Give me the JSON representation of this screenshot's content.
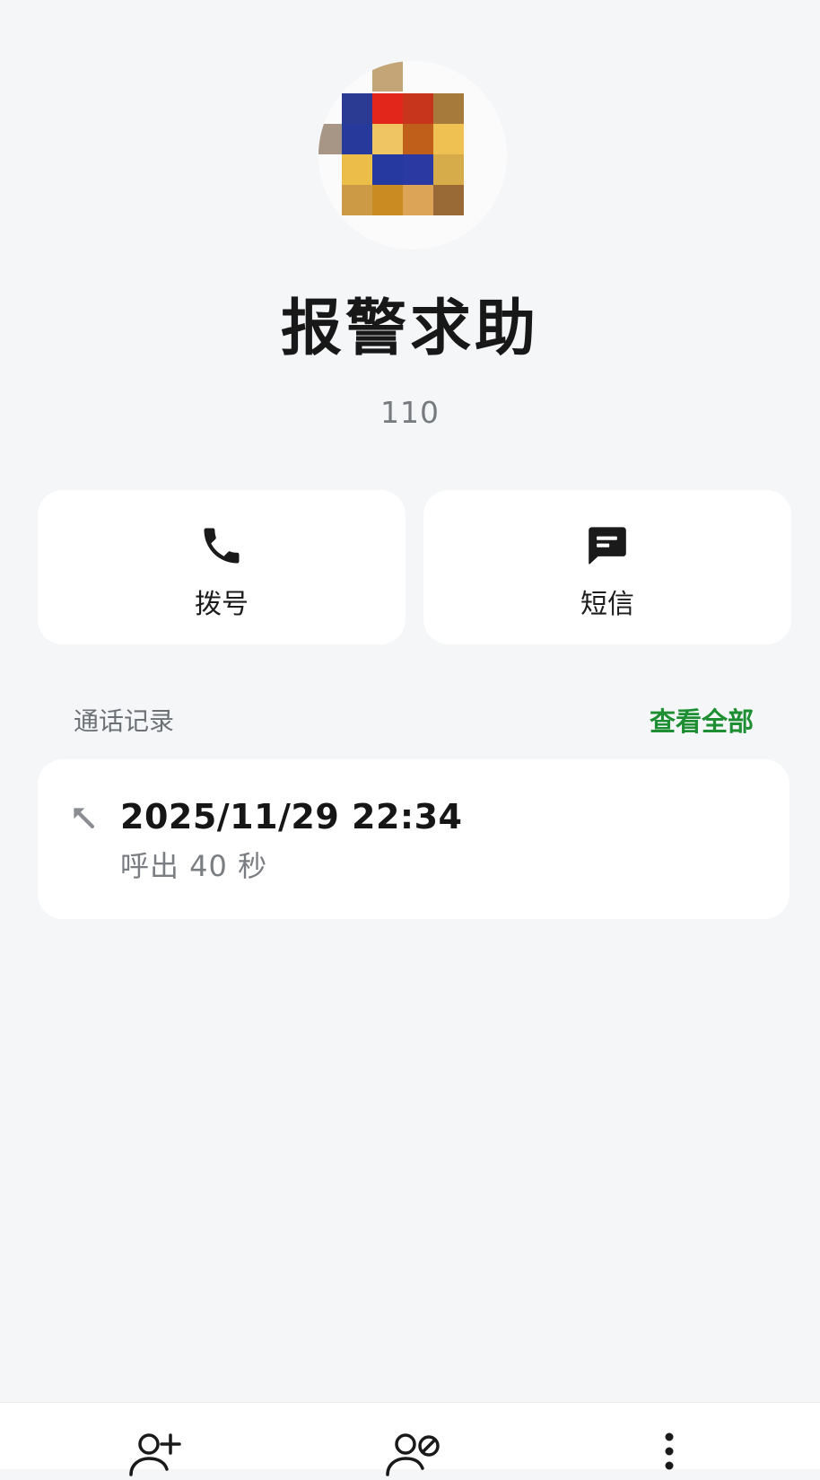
{
  "contact": {
    "name": "报警求助",
    "number": "110"
  },
  "actions": {
    "call_label": "拨号",
    "sms_label": "短信"
  },
  "call_history": {
    "title": "通话记录",
    "view_all_label": "查看全部",
    "records": [
      {
        "datetime": "2025/11/29 22:34",
        "detail": "呼出  40 秒",
        "direction_icon": "outgoing-call-icon"
      }
    ]
  },
  "bottom_bar": {
    "icons": [
      "add-contact-icon",
      "block-contact-icon",
      "more-options-icon"
    ]
  },
  "colors": {
    "background": "#f4f6f8",
    "card": "#ffffff",
    "accent_green": "#1d8f32",
    "secondary_text": "#777a7e"
  }
}
